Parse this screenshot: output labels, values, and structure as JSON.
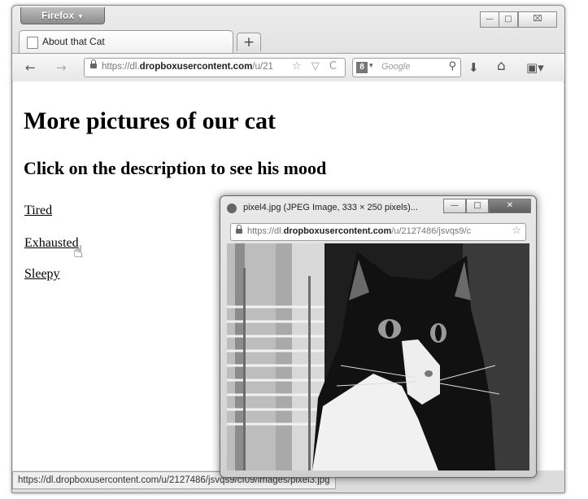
{
  "window": {
    "app_button": "Firefox",
    "minimize_glyph": "—",
    "maximize_glyph": "□",
    "close_glyph": "⌧"
  },
  "tab": {
    "title": "About that Cat",
    "new_tab": "+"
  },
  "navbar": {
    "back": "←",
    "forward": "→",
    "url_prefix": "https://dl.",
    "url_domain": "dropboxusercontent.com",
    "url_rest": "/u/21",
    "url_icons": "☆ ▽ C",
    "search_engine": "8",
    "search_placeholder": "Google",
    "download": "⬇",
    "home": "⌂",
    "menu": "▣▾"
  },
  "page": {
    "heading": "More pictures of our cat",
    "subheading": "Click on the description to see his mood",
    "links": [
      "Tired",
      "Exhausted",
      "Sleepy"
    ]
  },
  "status_bar": {
    "text": "https://dl.dropboxusercontent.com/u/2127486/jsvqs9/cf09/images/pixel3.jpg"
  },
  "popup": {
    "title": "pixel4.jpg (JPEG Image, 333 × 250 pixels)...",
    "url_prefix": "https://dl.",
    "url_domain": "dropboxusercontent.com",
    "url_rest": "/u/2127486/jsvqs9/c",
    "image_name": "cat-photo"
  }
}
